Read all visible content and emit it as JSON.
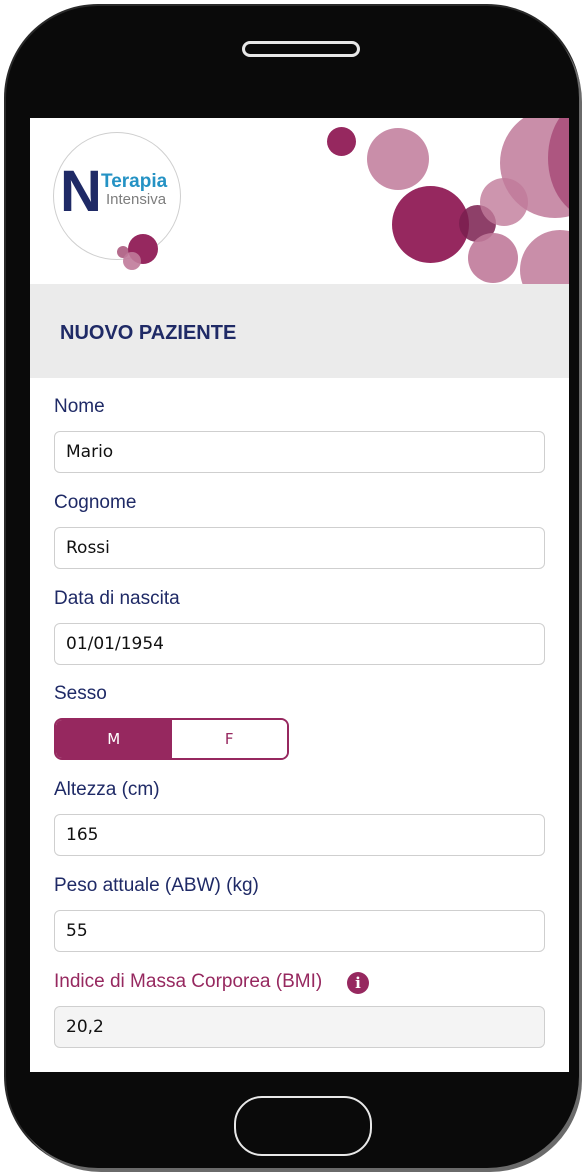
{
  "app": {
    "logo": {
      "main": "N",
      "line1": "Terapia",
      "line2": "Intensiva"
    },
    "section_title": "NUOVO PAZIENTE"
  },
  "form": {
    "nome": {
      "label": "Nome",
      "value": "Mario"
    },
    "cognome": {
      "label": "Cognome",
      "value": "Rossi"
    },
    "data_nascita": {
      "label": "Data di nascita",
      "value": "01/01/1954"
    },
    "sesso": {
      "label": "Sesso",
      "options": [
        "M",
        "F"
      ],
      "selected": "M"
    },
    "altezza": {
      "label": "Altezza (cm)",
      "value": "165"
    },
    "peso": {
      "label": "Peso attuale (ABW) (kg)",
      "value": "55"
    },
    "bmi": {
      "label": "Indice di Massa Corporea (BMI)",
      "value": "20,2",
      "info_icon": "info-icon"
    }
  },
  "colors": {
    "brand_navy": "#1f2a66",
    "accent_magenta": "#96285f",
    "accent_light": "#c07a9a",
    "header_bar": "#ebebeb"
  }
}
